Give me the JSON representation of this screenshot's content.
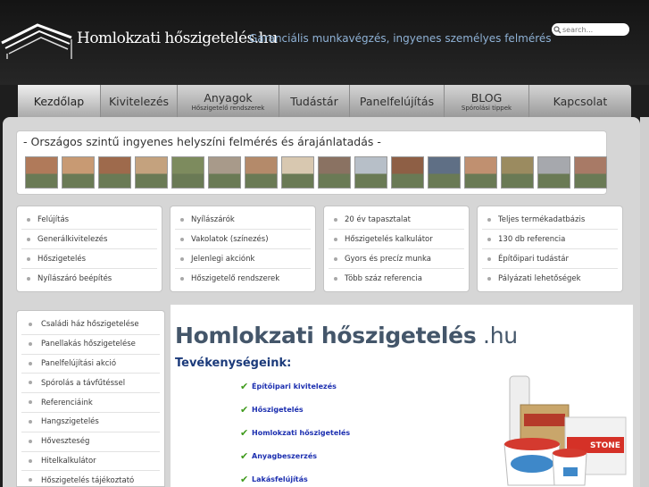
{
  "header": {
    "site_title": "Homlokzati hőszigetelés.hu",
    "tagline": "Garanciális munkavégzés, ingyenes személyes felmérés",
    "search_placeholder": "search..."
  },
  "nav": [
    {
      "label": "Kezdőlap",
      "sub": ""
    },
    {
      "label": "Kivitelezés",
      "sub": ""
    },
    {
      "label": "Anyagok",
      "sub": "Hőszigetelő rendszerek"
    },
    {
      "label": "Tudástár",
      "sub": ""
    },
    {
      "label": "Panelfelújítás",
      "sub": ""
    },
    {
      "label": "BLOG",
      "sub": "Spórolási tippek"
    },
    {
      "label": "Kapcsolat",
      "sub": ""
    }
  ],
  "strip": {
    "title": "- Országos szintű ingyenes helyszíni felmérés és árajánlatadás -"
  },
  "thumb_colors": [
    "#b07a5a",
    "#c89a73",
    "#9e6a4c",
    "#c4a27e",
    "#7d8b5e",
    "#a89a8a",
    "#b48a6a",
    "#d8c8b0",
    "#8a7262",
    "#b7bfc8",
    "#8e5f45",
    "#5f6f85",
    "#c09070",
    "#9b8b60",
    "#a6a8ad",
    "#a87a66"
  ],
  "boxes": [
    [
      "Felújítás",
      "Generálkivitelezés",
      "Hőszigetelés",
      "Nyílászáró beépítés"
    ],
    [
      "Nyílászárók",
      "Vakolatok (színezés)",
      "Jelenlegi akciónk",
      "Hőszigetelő rendszerek"
    ],
    [
      "20 év tapasztalat",
      "Hőszigetelés kalkulátor",
      "Gyors és precíz munka",
      "Több száz referencia"
    ],
    [
      "Teljes termékadatbázis",
      "130 db referencia",
      "Építőipari tudástár",
      "Pályázati lehetőségek"
    ]
  ],
  "sidebar": [
    "Családi ház hőszigetelése",
    "Panellakás hőszigetelése",
    "Panelfelújítási akció",
    "Spórolás a távfűtéssel",
    "Referenciáink",
    "Hangszigetelés",
    "Hőveszteség",
    "Hitelkalkulátor",
    "Hőszigetelés tájékoztató"
  ],
  "main": {
    "heading": "Homlokzati hőszigetelés",
    "heading_suffix": " .hu",
    "subheading": "Tevékenységeink:",
    "activities": [
      "Építőipari kivitelezés",
      "Hőszigetelés",
      "Homlokzati hőszigetelés",
      "Anyagbeszerzés",
      "Lakásfelújítás"
    ],
    "products_brand": "STONE"
  }
}
